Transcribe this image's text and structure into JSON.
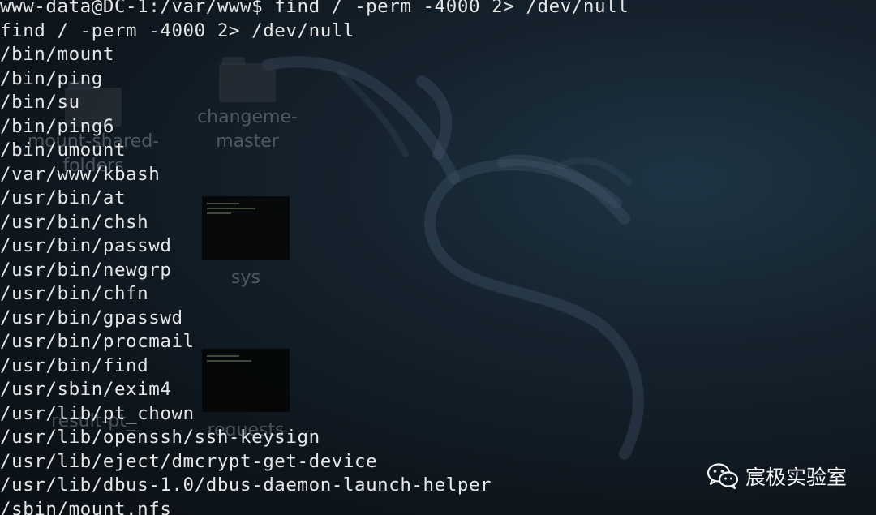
{
  "desktop": {
    "icons": [
      {
        "label_1": "mount-shared-",
        "label_2": "folders"
      },
      {
        "label_1": "changeme-",
        "label_2": "master"
      },
      {
        "label": "sys"
      },
      {
        "label": "requests"
      },
      {
        "label": "result-pt_"
      }
    ]
  },
  "terminal": {
    "lines": [
      "www-data@DC-1:/var/www$ find / -perm -4000 2> /dev/null",
      "find / -perm -4000 2> /dev/null",
      "/bin/mount",
      "/bin/ping",
      "/bin/su",
      "/bin/ping6",
      "/bin/umount",
      "/var/www/kbash",
      "/usr/bin/at",
      "/usr/bin/chsh",
      "/usr/bin/passwd",
      "/usr/bin/newgrp",
      "/usr/bin/chfn",
      "/usr/bin/gpasswd",
      "/usr/bin/procmail",
      "/usr/bin/find",
      "/usr/sbin/exim4",
      "/usr/lib/pt_chown",
      "/usr/lib/openssh/ssh-keysign",
      "/usr/lib/eject/dmcrypt-get-device",
      "/usr/lib/dbus-1.0/dbus-daemon-launch-helper",
      "/sbin/mount.nfs"
    ]
  },
  "watermark": {
    "icon": "wechat-icon",
    "text": "宸极实验室"
  },
  "colors": {
    "terminal_text": "#e6e6e6",
    "background": "#15222d",
    "watermark_text": "#f4f4f4"
  }
}
